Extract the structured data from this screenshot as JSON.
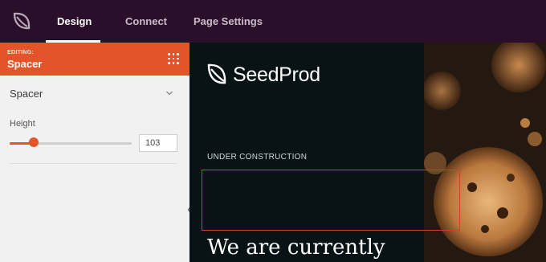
{
  "topbar": {
    "tabs": [
      {
        "label": "Design",
        "active": true
      },
      {
        "label": "Connect",
        "active": false
      },
      {
        "label": "Page Settings",
        "active": false
      }
    ]
  },
  "sidebar": {
    "editing_label": "EDITING:",
    "editing_title": "Spacer",
    "section_title": "Spacer",
    "height_label": "Height",
    "height_value": "103",
    "slider_fraction": 0.2
  },
  "preview": {
    "brand": "SeedProd",
    "subheading": "UNDER CONSTRUCTION",
    "headline": "We are currently"
  },
  "colors": {
    "topbar": "#2b0f2a",
    "accent": "#e4542b",
    "sidebar": "#f1f1f1",
    "canvas": "#091214"
  },
  "icons": [
    "seedprod-logo-icon",
    "grip-dots-icon",
    "chevron-down-icon",
    "chevron-left-icon"
  ]
}
